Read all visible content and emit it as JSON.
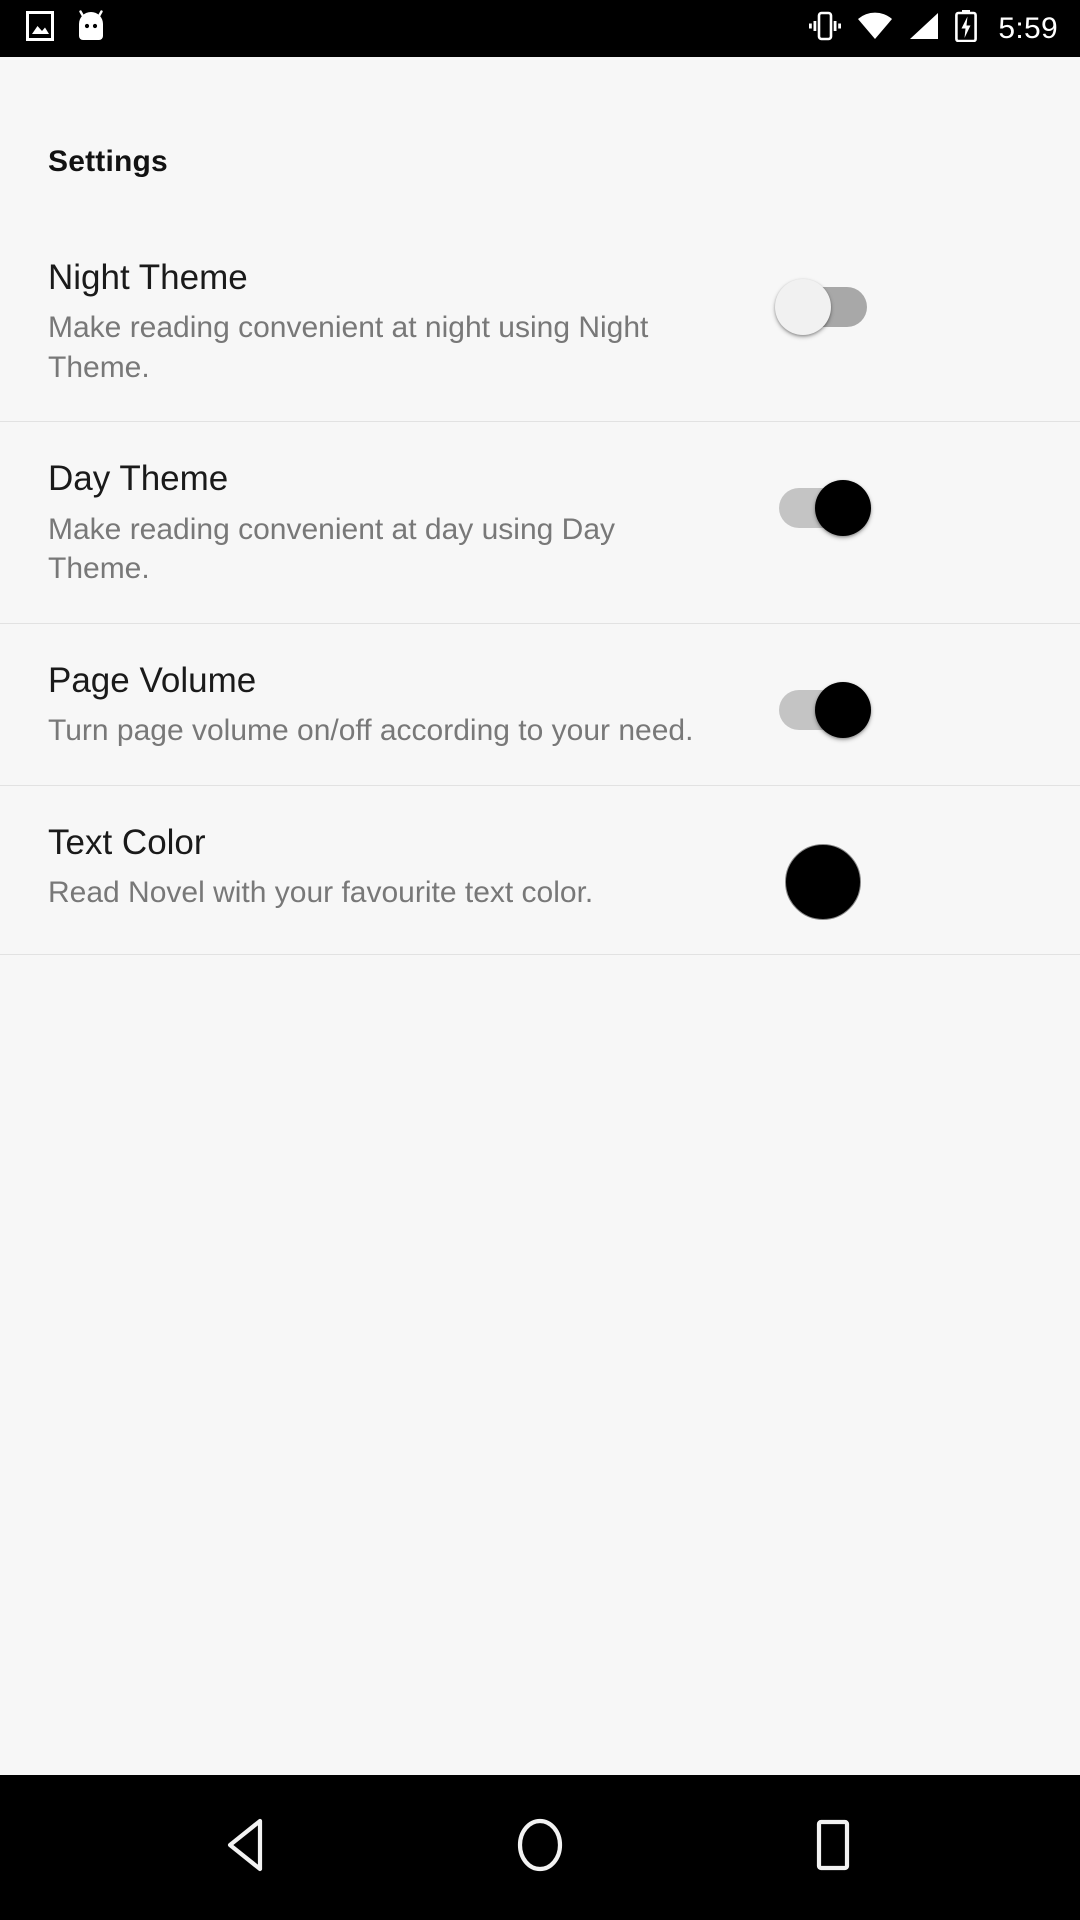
{
  "status_bar": {
    "left_icons": [
      {
        "name": "photo-icon",
        "label": "Screenshot"
      },
      {
        "name": "android-mascot-icon",
        "label": "Android System"
      }
    ],
    "right_icons": [
      {
        "name": "vibrate-icon",
        "label": "Ringer vibrate"
      },
      {
        "name": "wifi-icon",
        "label": "Wi-Fi full signal"
      },
      {
        "name": "cellular-signal-icon",
        "label": "Cellular signal"
      },
      {
        "name": "battery-charging-icon",
        "label": "Battery charging"
      }
    ],
    "time": "5:59",
    "background_color": "#000000",
    "foreground_color": "#ffffff"
  },
  "header": {
    "title": "Settings"
  },
  "settings": {
    "rows": [
      {
        "id": "night-theme",
        "title": "Night Theme",
        "subtitle": "Make reading convenient at night using Night Theme.",
        "control": "toggle",
        "state": "off",
        "state_label": "Off"
      },
      {
        "id": "day-theme",
        "title": "Day Theme",
        "subtitle": "Make reading convenient at day using Day Theme.",
        "control": "toggle",
        "state": "on",
        "state_label": "On"
      },
      {
        "id": "page-volume",
        "title": "Page Volume",
        "subtitle": "Turn page volume on/off according to your need.",
        "control": "toggle",
        "state": "on",
        "state_label": "On"
      },
      {
        "id": "text-color",
        "title": "Text Color",
        "subtitle": "Read Novel with your favourite text color.",
        "control": "color-swatch",
        "state": "selected",
        "color": "#000000"
      }
    ]
  },
  "nav_bar": {
    "buttons": [
      {
        "name": "back-button",
        "label": "Back"
      },
      {
        "name": "home-button",
        "label": "Home"
      },
      {
        "name": "recents-button",
        "label": "Recent apps"
      }
    ],
    "background_color": "#000000"
  },
  "theme": {
    "page_background": "#f7f7f7",
    "title_color": "#1a1a1a",
    "subtitle_color": "#787878",
    "divider_color": "#e2e2e2",
    "toggle_on_thumb": "#000000",
    "toggle_on_track": "#c4c4c4",
    "toggle_off_thumb": "#f1f1f1",
    "toggle_off_track": "#a8a8a8"
  }
}
